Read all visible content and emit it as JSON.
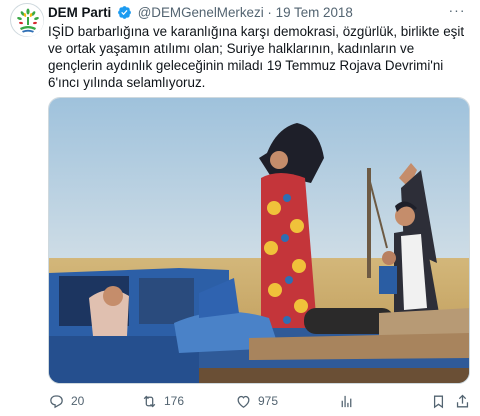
{
  "tweet": {
    "author_name": "DEM Parti",
    "handle": "@DEMGenelMerkezi",
    "separator": "·",
    "date": "19 Tem 2018",
    "text": "IŞİD barbarlığına ve karanlığına karşı demokrasi, özgürlük, birlikte eşit ve ortak yaşamın atılımı olan; Suriye halklarının, kadınların ve gençlerin aydınlık geleceğinin miladı 19 Temmuz Rojava Devrimi'ni 6'ıncı yılında selamlıyoruz.",
    "verified": true,
    "media_alt": "photo-people-celebrating-on-pickup-truck"
  },
  "actions": {
    "reply_count": "20",
    "retweet_count": "176",
    "like_count": "975"
  },
  "colors": {
    "text": "#0f1419",
    "muted": "#536471",
    "verified": "#1d9bf0",
    "logo_green": "#3aa845"
  },
  "icons": [
    "verified-badge-icon",
    "more-icon",
    "reply-icon",
    "retweet-icon",
    "like-icon",
    "analytics-icon",
    "bookmark-icon",
    "share-icon"
  ]
}
